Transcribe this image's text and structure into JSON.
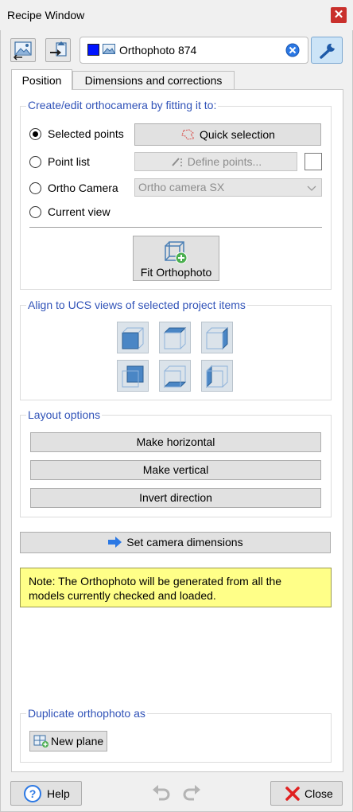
{
  "window": {
    "title": "Recipe Window",
    "close_glyph": "✕"
  },
  "header": {
    "item_name": "Orthophoto 874",
    "item_color": "#0014ff",
    "left_buttons": [
      "photo-import-icon",
      "export-arrow-icon"
    ],
    "clear_icon": "blue-x-circle-icon",
    "settings_icon": "wrench-icon"
  },
  "tabs": [
    {
      "label": "Position",
      "active": true
    },
    {
      "label": "Dimensions and corrections",
      "active": false
    }
  ],
  "fit_group": {
    "title": "Create/edit orthocamera by fitting it to:",
    "options": [
      {
        "label": "Selected points",
        "selected": true
      },
      {
        "label": "Point list",
        "selected": false
      },
      {
        "label": "Ortho Camera",
        "selected": false
      },
      {
        "label": "Current view",
        "selected": false
      }
    ],
    "quick_selection_label": "Quick selection",
    "define_points_label": "Define points...",
    "ortho_camera_select": "Ortho camera SX",
    "fit_button_label": "Fit Orthophoto"
  },
  "align_group": {
    "title": "Align to UCS views of selected project items",
    "views": [
      "front-view-icon",
      "top-view-icon",
      "right-view-icon",
      "back-view-icon",
      "bottom-view-icon",
      "left-view-icon"
    ]
  },
  "layout_group": {
    "title": "Layout options",
    "buttons": [
      "Make horizontal",
      "Make vertical",
      "Invert direction"
    ]
  },
  "set_camera_label": "Set camera dimensions",
  "note": {
    "line1": "Note: The Orthophoto will be generated from all the",
    "line2": "models currently checked and loaded."
  },
  "duplicate_group": {
    "title": "Duplicate orthophoto as",
    "new_plane_label": "New plane"
  },
  "footer": {
    "help_label": "Help",
    "help_glyph": "?",
    "close_label": "Close"
  }
}
